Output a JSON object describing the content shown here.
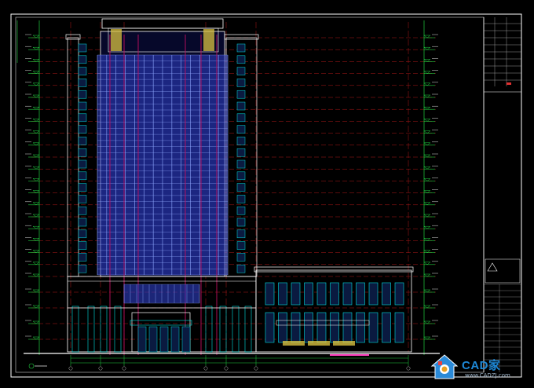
{
  "drawing": {
    "background": "#000000",
    "colors": {
      "frame": "#ffffff",
      "glass": "#3040c8",
      "mullion": "#8fa8ff",
      "cyan": "#00e0e0",
      "grid_red": "#b01818",
      "grid_magenta": "#c01060",
      "level_green": "#20d040",
      "yellow": "#d8c040",
      "pink": "#ff40c0"
    },
    "level_count": 24,
    "title_block_lines": [
      "",
      "",
      "",
      "",
      "",
      "",
      "",
      "",
      "",
      "",
      "",
      "",
      "",
      ""
    ]
  },
  "watermark": {
    "brand": "CAD家",
    "url": "www.CADZJ.com",
    "icon": "cad-home-logo-icon"
  }
}
